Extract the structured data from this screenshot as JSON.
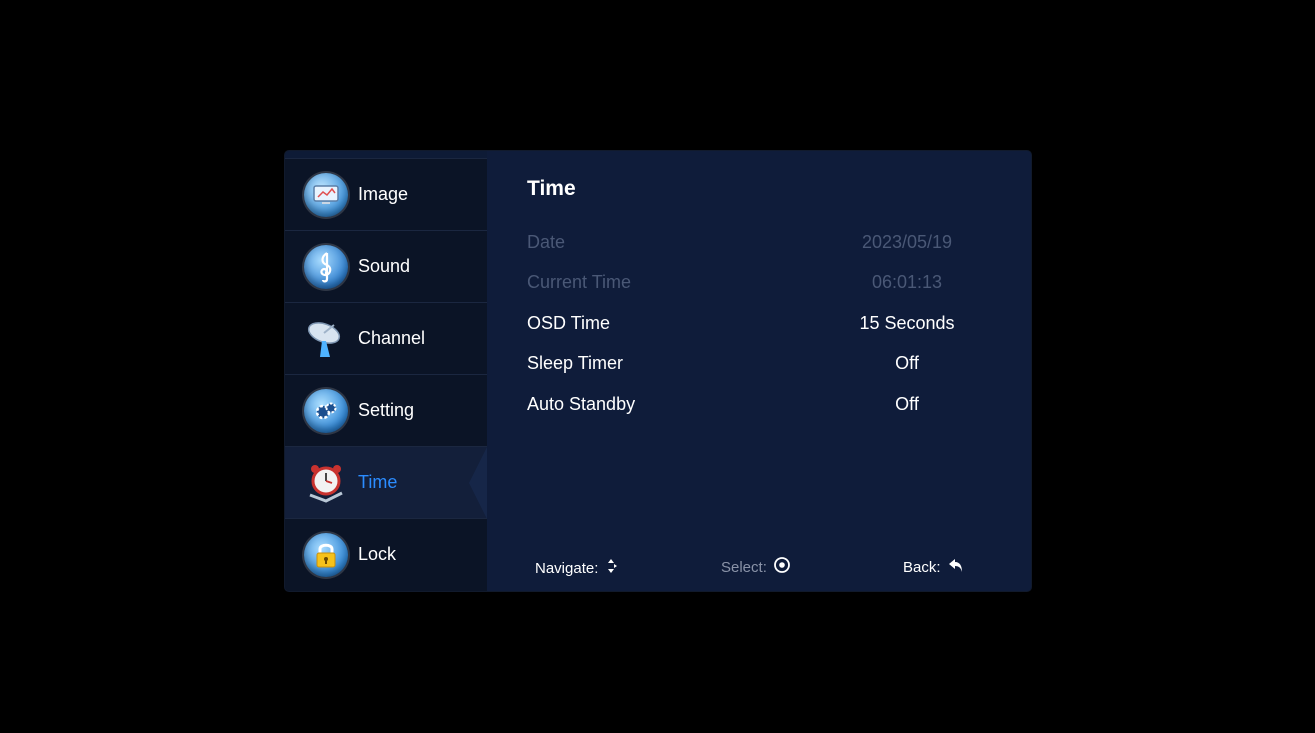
{
  "sidebar": {
    "items": [
      {
        "label": "Image",
        "icon": "monitor-icon"
      },
      {
        "label": "Sound",
        "icon": "treble-clef-icon"
      },
      {
        "label": "Channel",
        "icon": "satellite-dish-icon"
      },
      {
        "label": "Setting",
        "icon": "gears-icon"
      },
      {
        "label": "Time",
        "icon": "alarm-clock-icon",
        "active": true
      },
      {
        "label": "Lock",
        "icon": "padlock-icon"
      }
    ]
  },
  "content": {
    "title": "Time",
    "rows": [
      {
        "label": "Date",
        "value": "2023/05/19",
        "enabled": false
      },
      {
        "label": "Current Time",
        "value": "06:01:13",
        "enabled": false
      },
      {
        "label": "OSD Time",
        "value": "15 Seconds",
        "enabled": true
      },
      {
        "label": "Sleep Timer",
        "value": "Off",
        "enabled": true
      },
      {
        "label": "Auto Standby",
        "value": "Off",
        "enabled": true
      }
    ]
  },
  "footer": {
    "navigate_label": "Navigate:",
    "select_label": "Select:",
    "back_label": "Back:"
  },
  "colors": {
    "background": "#000000",
    "panel": "#0f1c3a",
    "sidebar": "#0b1426",
    "active_text": "#2b8cff",
    "disabled_text": "#4a5876"
  }
}
